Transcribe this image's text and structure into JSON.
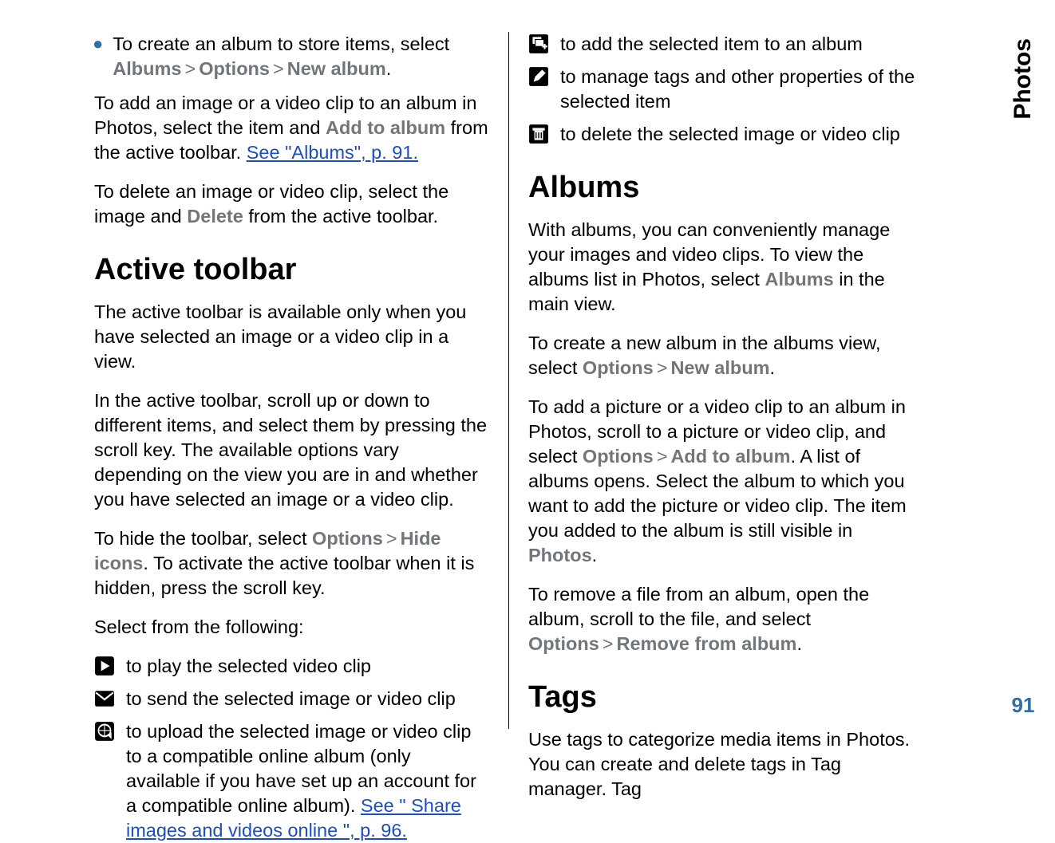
{
  "side": {
    "tab": "Photos",
    "page": "91"
  },
  "left": {
    "bullet1_pre": "To create an album to store items, select ",
    "bullet1_b1": "Albums",
    "bullet1_b2": "Options",
    "bullet1_b3": "New album",
    "p1_a": "To add an image or a video clip to an album in Photos, select the item and ",
    "p1_b": "Add to album",
    "p1_c": " from the active toolbar. ",
    "p1_link": "See \"Albums\", p. 91.",
    "p2_a": "To delete an image or video clip, select the image and ",
    "p2_b": "Delete",
    "p2_c": " from the active toolbar.",
    "h2a": "Active toolbar",
    "p3": "The active toolbar is available only when you have selected an image or a video clip in a view.",
    "p4": "In the active toolbar, scroll up or down to different items, and select them by pressing the scroll key. The available options vary depending on the view you are in and whether you have selected an image or a video clip.",
    "p5_a": "To hide the toolbar, select ",
    "p5_b1": "Options",
    "p5_b2": "Hide icons",
    "p5_c": ". To activate the active toolbar when it is hidden, press the scroll key.",
    "p6": "Select from the following:",
    "icon_play": "to play the selected video clip",
    "icon_send": "to send the selected image or video clip",
    "icon_upload": "to upload the selected image or video clip to a compatible online album (only available if you have set up an account for a compatible online album). ",
    "icon_upload_link": "See \" Share images and videos online \", p. 96."
  },
  "right": {
    "icon_addalbum": "to add the selected item to an album",
    "icon_tags": "to manage tags and other properties of the selected item",
    "icon_delete": "to delete the selected image or video clip",
    "h2a": "Albums",
    "p1_a": "With albums, you can conveniently manage your images and video clips. To view the albums list in Photos, select ",
    "p1_b": "Albums",
    "p1_c": " in the main view.",
    "p2_a": "To create a new album in the albums view, select ",
    "p2_b1": "Options",
    "p2_b2": "New album",
    "p3_a": "To add a picture or a video clip to an album in Photos, scroll to a picture or video clip, and select ",
    "p3_b1": "Options",
    "p3_b2": "Add to album",
    "p3_c": ". A list of albums opens. Select the album to which you want to add the picture or video clip. The item you added to the album is still visible in ",
    "p3_d": "Photos",
    "p3_e": ".",
    "p4_a": "To remove a file from an album, open the album, scroll to the file, and select ",
    "p4_b1": "Options",
    "p4_b2": "Remove from album",
    "p4_c": ".",
    "h2b": "Tags",
    "p5": "Use tags to categorize media items in Photos. You can create and delete tags in Tag manager. Tag"
  },
  "sep": ">"
}
